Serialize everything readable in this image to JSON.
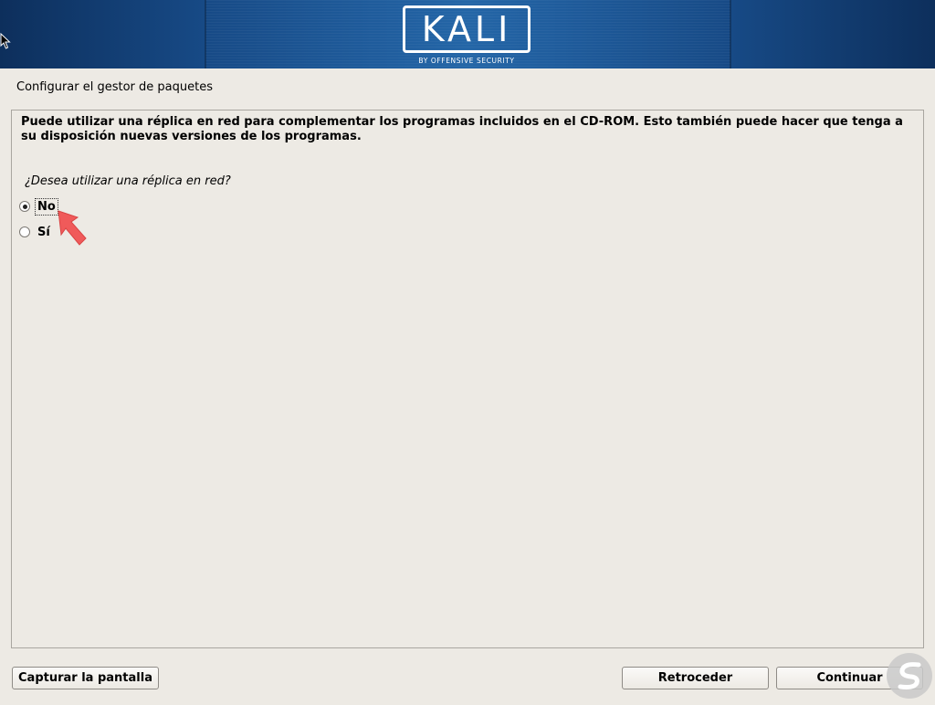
{
  "banner": {
    "logo_text": "KALI",
    "logo_subtitle": "BY OFFENSIVE SECURITY"
  },
  "step": {
    "title": "Configurar el gestor de paquetes"
  },
  "main": {
    "description": "Puede utilizar una réplica en red para complementar los programas incluidos en el CD-ROM. Esto también puede hacer que tenga a su disposición nuevas versiones de los programas.",
    "question": "¿Desea utilizar una réplica en red?",
    "options": [
      {
        "label": "No",
        "selected": true
      },
      {
        "label": "Sí",
        "selected": false
      }
    ]
  },
  "buttons": {
    "capture": "Capturar la pantalla",
    "back": "Retroceder",
    "continue": "Continuar"
  },
  "colors": {
    "banner_dark": "#0d2f5c",
    "banner_light": "#2466a7",
    "background": "#edeae4",
    "annotation_arrow": "#f05a5a",
    "watermark": "#c9c9c9"
  },
  "icons": {
    "cursor": "mouse-pointer-icon",
    "annotation": "red-arrow-icon",
    "watermark": "watermark-logo-icon"
  }
}
